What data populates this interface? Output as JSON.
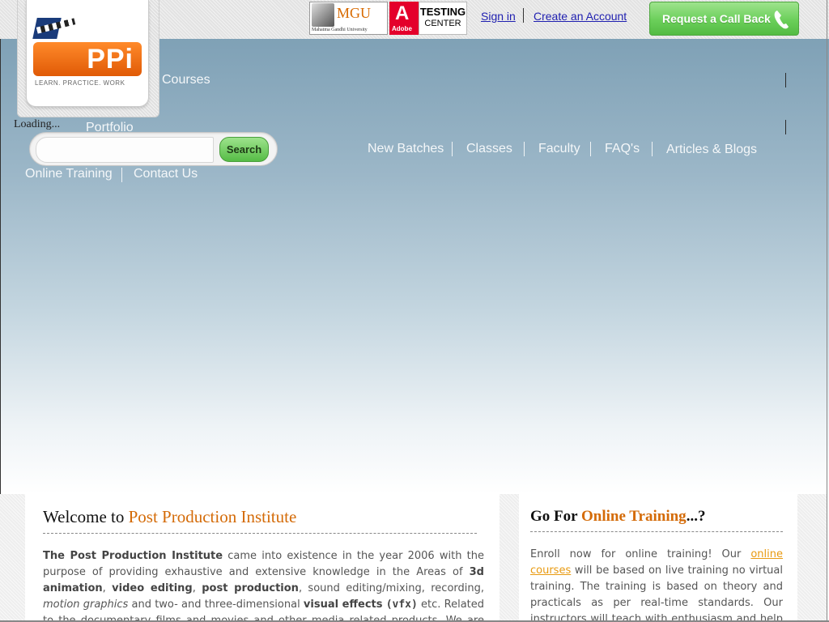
{
  "header": {
    "logo_text": "PPi",
    "logo_tagline": "LEARN. PRACTICE. WORK",
    "loading_text": "Loading...",
    "mgu_logo_text": "MGU",
    "mgu_logo_sub": "Mahatma Gandhi University",
    "adobe_logo_letter": "A",
    "adobe_logo_word": "Adobe",
    "testing_center_line1": "TESTING",
    "testing_center_line2": "CENTER",
    "sign_in": "Sign in",
    "create_account": "Create an Account",
    "callback_label": "Request a Call Back"
  },
  "nav": {
    "courses": "Courses",
    "portfolio": "Portfolio",
    "new_batches": "New Batches",
    "classes": "Classes",
    "faculty": "Faculty",
    "faqs": "FAQ's",
    "articles_blogs": "Articles & Blogs",
    "online_training": "Online Training",
    "contact_us": "Contact Us"
  },
  "search": {
    "placeholder": "",
    "value": "",
    "button_label": "Search"
  },
  "welcome": {
    "heading_prefix": "Welcome to ",
    "heading_accent": "Post Production Institute",
    "body": [
      {
        "t": "b",
        "v": "The Post Production Institute"
      },
      {
        "t": "s",
        "v": " came into existence in the year 2006 with the purpose of providing exhaustive and extensive knowledge in the Areas of "
      },
      {
        "t": "b",
        "v": "3d animation"
      },
      {
        "t": "s",
        "v": ", "
      },
      {
        "t": "b",
        "v": "video editing"
      },
      {
        "t": "s",
        "v": ", "
      },
      {
        "t": "b",
        "v": "post production"
      },
      {
        "t": "s",
        "v": ", sound editing/mixing, recording, "
      },
      {
        "t": "i",
        "v": "motion graphics"
      },
      {
        "t": "s",
        "v": " and two- and three-dimensional "
      },
      {
        "t": "b",
        "v": "visual effects"
      },
      {
        "t": "s",
        "v": " "
      },
      {
        "t": "m",
        "v": "(vfx)"
      },
      {
        "t": "s",
        "v": " etc. Related to the documentary films and movies and other media related products. We are very much pleased to have"
      }
    ]
  },
  "online": {
    "heading_prefix": "Go For ",
    "heading_accent": "Online Training",
    "heading_suffix": "...?",
    "body": [
      {
        "t": "s",
        "v": "Enroll now for online training! Our "
      },
      {
        "t": "a",
        "v": "online courses"
      },
      {
        "t": "s",
        "v": " will be based on live training no virtual training. The training is based on theory and practicals as per real-time standards. Our instructors will teach with enthusiasm and help you understand"
      }
    ]
  },
  "colors": {
    "accent_orange": "#d46b08",
    "link_orange": "#e89a10",
    "callback_green": "#6bcf5a",
    "hero_top": "#7fa1b6",
    "top_link_blue": "#1f1fb0"
  }
}
